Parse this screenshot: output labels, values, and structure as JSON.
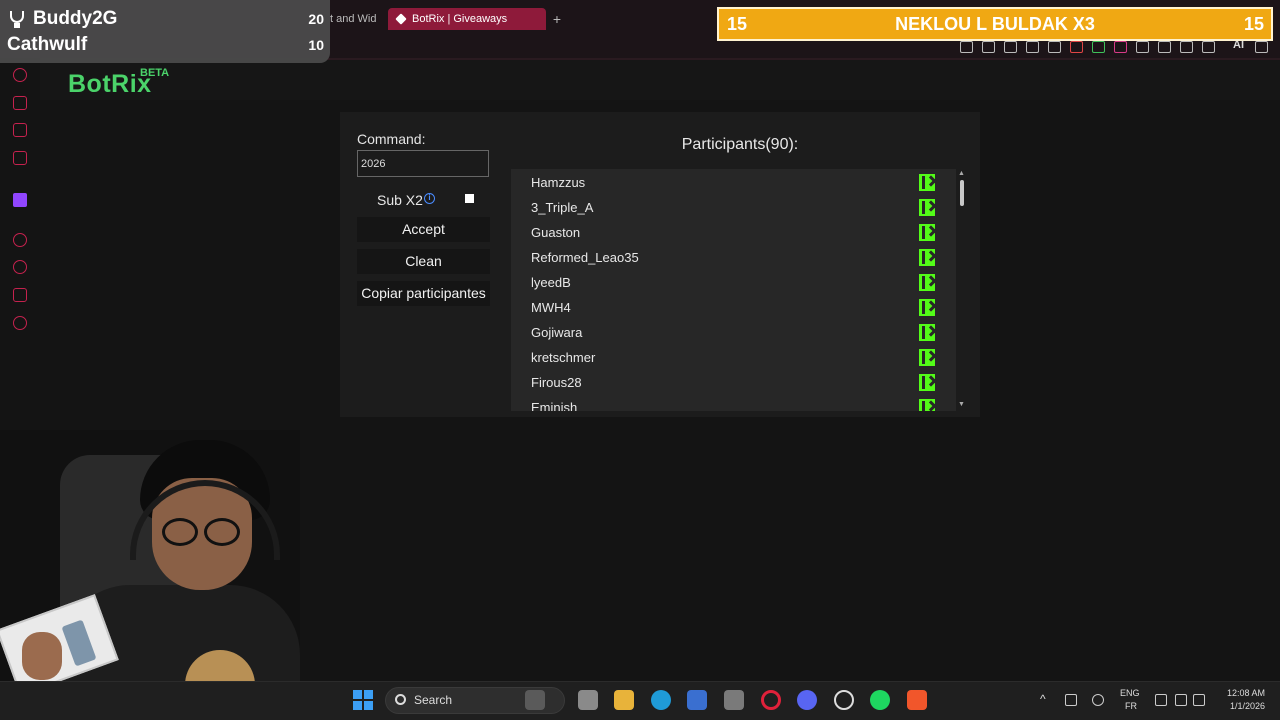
{
  "browser": {
    "prev_tab_label": "t and Wid",
    "active_tab_label": "BotRix | Giveaways",
    "new_tab_glyph": "+",
    "toolbar_ai_label": "AI"
  },
  "app": {
    "logo": "BotRix",
    "logo_badge": "BETA",
    "brand_color": "#4bd36a",
    "accent_color": "#c5224e"
  },
  "giveaway": {
    "command_label": "Command:",
    "command_value": "2026",
    "sub_x2_label": "Sub X2",
    "sub_x2_info_glyph": "i",
    "sub_x2_checked": false,
    "accept_label": "Accept",
    "clean_label": "Clean",
    "copy_label": "Copiar participantes",
    "participants_title": "Participants(90):",
    "participants": [
      {
        "name": "Hamzzus",
        "platform": "kick"
      },
      {
        "name": "3_Triple_A",
        "platform": "kick"
      },
      {
        "name": "Guaston",
        "platform": "kick"
      },
      {
        "name": "Reformed_Leao35",
        "platform": "kick"
      },
      {
        "name": "lyeedB",
        "platform": "kick"
      },
      {
        "name": "MWH4",
        "platform": "kick"
      },
      {
        "name": "Gojiwara",
        "platform": "kick"
      },
      {
        "name": "kretschmer",
        "platform": "kick"
      },
      {
        "name": "Firous28",
        "platform": "kick"
      },
      {
        "name": "Eminish",
        "platform": "kick"
      }
    ],
    "scroll_up_glyph": "▲",
    "scroll_down_glyph": "▼"
  },
  "overlay": {
    "leaderboard": [
      {
        "name": "Buddy2G",
        "score": "20"
      },
      {
        "name": "Cathwulf",
        "score": "10"
      }
    ],
    "banner_left": "15",
    "banner_title": "NEKLOU L BULDAK X3",
    "banner_right": "15",
    "banner_color": "#f0a813"
  },
  "taskbar": {
    "search_label": "Search",
    "lang_1": "ENG",
    "lang_2": "FR",
    "time": "12:08 AM",
    "date": "1/1/2026",
    "tray_chevron": "^"
  }
}
